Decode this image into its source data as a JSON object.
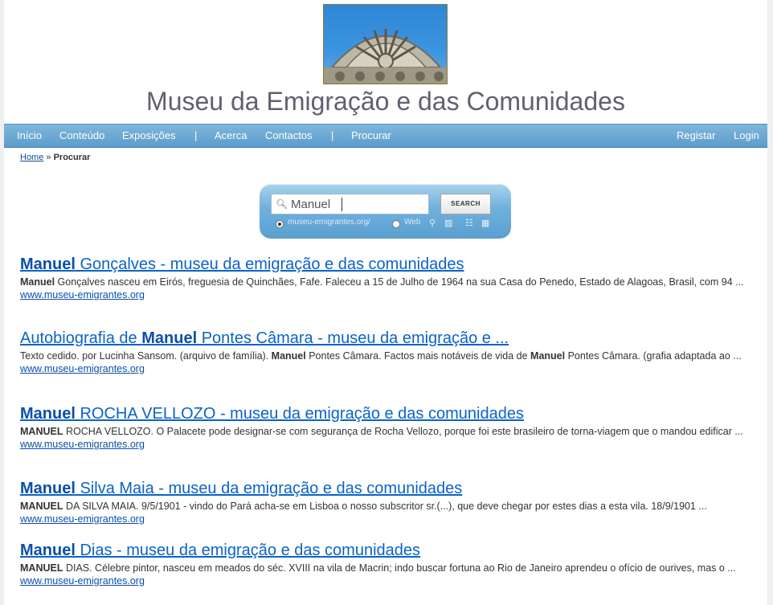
{
  "site": {
    "title": "Museu da Emigração e das Comunidades"
  },
  "nav": {
    "left": [
      "Início",
      "Conteúdo",
      "Exposições",
      "Acerca",
      "Contactos",
      "Procurar"
    ],
    "separator": "|",
    "right": [
      "Registar",
      "Login"
    ]
  },
  "breadcrumb": {
    "home": "Home",
    "separator": "»",
    "current": "Procurar"
  },
  "search": {
    "query": "Manuel",
    "button": "SEARCH",
    "option_site": "museu-emigrantes.org/",
    "option_web": "Web",
    "selected_option": "museu-emigrantes.org/"
  },
  "results": [
    {
      "title_bold": "Manuel",
      "title_rest": " Gonçalves - museu da emigração e das comunidades",
      "snippet_bold": "Manuel",
      "snippet": " Gonçalves nasceu em Eirós, freguesia de Quinchães, Fafe. Faleceu a 15 de Julho de 1964 na sua Casa do Penedo, Estado de Alagoas, Brasil, com 94 ...",
      "url": "www.museu-emigrantes.org"
    },
    {
      "title_pre": "Autobiografia de ",
      "title_bold": "Manuel",
      "title_rest": " Pontes Câmara - museu da emigração e ...",
      "snippet_a": "Texto cedido. por Lucinha Sansom. (arquivo de família). ",
      "snippet_b1": "Manuel",
      "snippet_c": " Pontes Câmara. Factos mais notáveis de vida de ",
      "snippet_b2": "Manuel",
      "snippet_d": " Pontes Câmara. (grafia adaptada ao ...",
      "url": "www.museu-emigrantes.org"
    },
    {
      "title_bold": "Manuel",
      "title_rest": " ROCHA VELLOZO - museu da emigração e das comunidades",
      "snippet_bold": "MANUEL",
      "snippet": " ROCHA VELLOZO. O Palacete pode designar-se com segurança de Rocha Vellozo, porque foi este brasileiro de torna-viagem que o mandou edificar ...",
      "url": "www.museu-emigrantes.org"
    },
    {
      "title_bold": "Manuel",
      "title_rest": " Silva Maia - museu da emigração e das comunidades",
      "snippet_bold": "MANUEL",
      "snippet": " DA SILVA MAIA. 9/5/1901 - vindo do Pará acha-se em Lisboa o nosso subscritor sr.(...), que deve chegar por estes dias a esta vila. 18/9/1901 ...",
      "url": "www.museu-emigrantes.org"
    },
    {
      "title_bold": "Manuel",
      "title_rest": " Dias - museu da emigração e das comunidades",
      "snippet_bold": "MANUEL",
      "snippet": " DIAS. Célebre pintor, nasceu em meados do séc. XVIII na vila de Macrin; indo buscar fortuna ao Rio de Janeiro aprendeu o ofício de ourives, mas o ...",
      "url": "www.museu-emigrantes.org"
    }
  ]
}
